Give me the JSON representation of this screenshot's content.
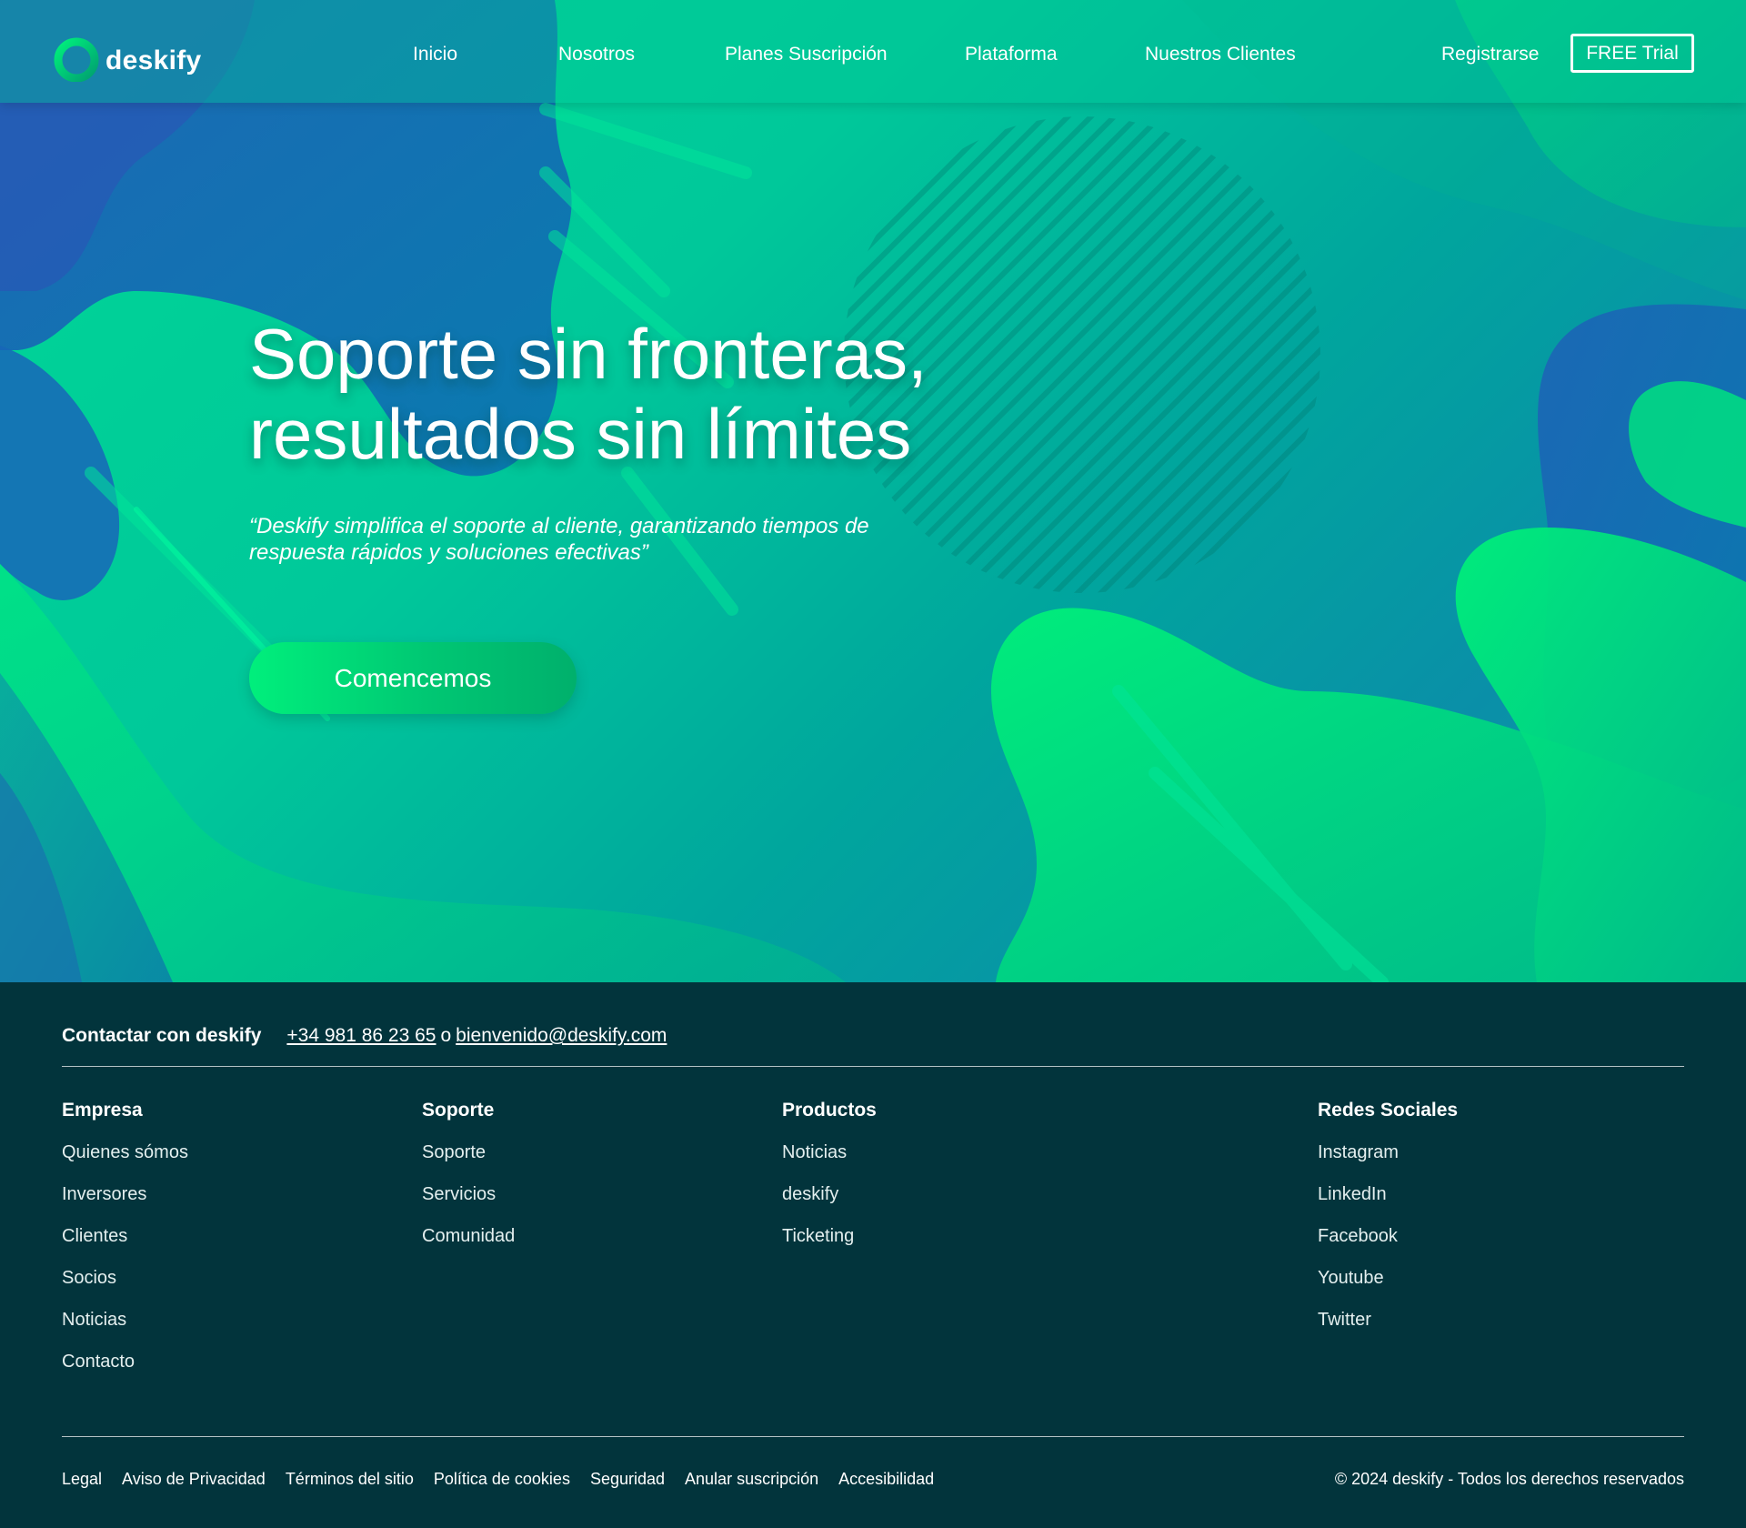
{
  "brand": {
    "name": "deskify",
    "accent": "#00e07c",
    "dark": "#02343c"
  },
  "nav": {
    "items": [
      {
        "label": "Inicio"
      },
      {
        "label": "Nosotros"
      },
      {
        "label": "Planes Suscripción"
      },
      {
        "label": "Plataforma"
      },
      {
        "label": "Nuestros Clientes"
      }
    ],
    "register": "Registrarse",
    "trial": "FREE Trial"
  },
  "hero": {
    "title_line1": "Soporte sin fronteras,",
    "title_line2": "resultados sin límites",
    "quote": "“Deskify simplifica el soporte al cliente, garantizando tiempos de respuesta rápidos y soluciones efectivas”",
    "cta": "Comencemos"
  },
  "footer": {
    "contact": {
      "label": "Contactar con deskify",
      "phone": "+34 981 86 23 65",
      "separator": "o",
      "email": "bienvenido@deskify.com"
    },
    "columns": [
      {
        "title": "Empresa",
        "links": [
          "Quienes sómos",
          "Inversores",
          "Clientes",
          "Socios",
          "Noticias",
          "Contacto"
        ]
      },
      {
        "title": "Soporte",
        "links": [
          "Soporte",
          "Servicios",
          "Comunidad"
        ]
      },
      {
        "title": "Productos",
        "links": [
          "Noticias",
          "deskify",
          "Ticketing"
        ]
      },
      {
        "title": "Redes Sociales",
        "links": [
          "Instagram",
          "LinkedIn",
          "Facebook",
          "Youtube",
          "Twitter"
        ]
      }
    ],
    "legal": [
      "Legal",
      "Aviso de Privacidad",
      "Términos del sitio",
      "Política de cookies",
      "Seguridad",
      "Anular suscripción",
      "Accesibilidad"
    ],
    "copyright": "© 2024 deskify - Todos los derechos reservados"
  }
}
